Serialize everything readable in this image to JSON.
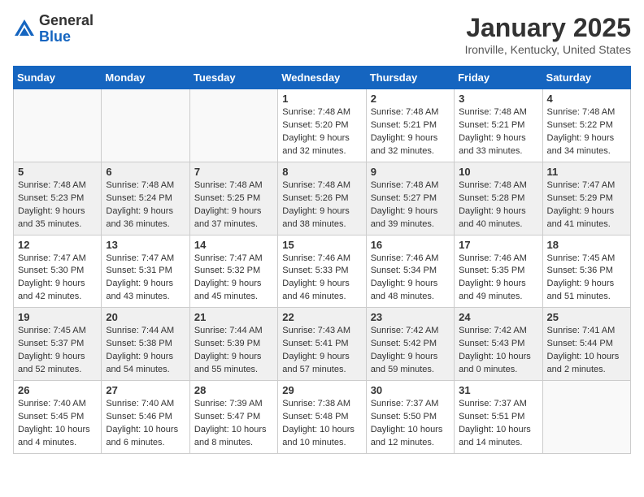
{
  "header": {
    "logo_general": "General",
    "logo_blue": "Blue",
    "month_title": "January 2025",
    "location": "Ironville, Kentucky, United States"
  },
  "days_of_week": [
    "Sunday",
    "Monday",
    "Tuesday",
    "Wednesday",
    "Thursday",
    "Friday",
    "Saturday"
  ],
  "weeks": [
    [
      {
        "day": "",
        "info": ""
      },
      {
        "day": "",
        "info": ""
      },
      {
        "day": "",
        "info": ""
      },
      {
        "day": "1",
        "info": "Sunrise: 7:48 AM\nSunset: 5:20 PM\nDaylight: 9 hours and 32 minutes."
      },
      {
        "day": "2",
        "info": "Sunrise: 7:48 AM\nSunset: 5:21 PM\nDaylight: 9 hours and 32 minutes."
      },
      {
        "day": "3",
        "info": "Sunrise: 7:48 AM\nSunset: 5:21 PM\nDaylight: 9 hours and 33 minutes."
      },
      {
        "day": "4",
        "info": "Sunrise: 7:48 AM\nSunset: 5:22 PM\nDaylight: 9 hours and 34 minutes."
      }
    ],
    [
      {
        "day": "5",
        "info": "Sunrise: 7:48 AM\nSunset: 5:23 PM\nDaylight: 9 hours and 35 minutes."
      },
      {
        "day": "6",
        "info": "Sunrise: 7:48 AM\nSunset: 5:24 PM\nDaylight: 9 hours and 36 minutes."
      },
      {
        "day": "7",
        "info": "Sunrise: 7:48 AM\nSunset: 5:25 PM\nDaylight: 9 hours and 37 minutes."
      },
      {
        "day": "8",
        "info": "Sunrise: 7:48 AM\nSunset: 5:26 PM\nDaylight: 9 hours and 38 minutes."
      },
      {
        "day": "9",
        "info": "Sunrise: 7:48 AM\nSunset: 5:27 PM\nDaylight: 9 hours and 39 minutes."
      },
      {
        "day": "10",
        "info": "Sunrise: 7:48 AM\nSunset: 5:28 PM\nDaylight: 9 hours and 40 minutes."
      },
      {
        "day": "11",
        "info": "Sunrise: 7:47 AM\nSunset: 5:29 PM\nDaylight: 9 hours and 41 minutes."
      }
    ],
    [
      {
        "day": "12",
        "info": "Sunrise: 7:47 AM\nSunset: 5:30 PM\nDaylight: 9 hours and 42 minutes."
      },
      {
        "day": "13",
        "info": "Sunrise: 7:47 AM\nSunset: 5:31 PM\nDaylight: 9 hours and 43 minutes."
      },
      {
        "day": "14",
        "info": "Sunrise: 7:47 AM\nSunset: 5:32 PM\nDaylight: 9 hours and 45 minutes."
      },
      {
        "day": "15",
        "info": "Sunrise: 7:46 AM\nSunset: 5:33 PM\nDaylight: 9 hours and 46 minutes."
      },
      {
        "day": "16",
        "info": "Sunrise: 7:46 AM\nSunset: 5:34 PM\nDaylight: 9 hours and 48 minutes."
      },
      {
        "day": "17",
        "info": "Sunrise: 7:46 AM\nSunset: 5:35 PM\nDaylight: 9 hours and 49 minutes."
      },
      {
        "day": "18",
        "info": "Sunrise: 7:45 AM\nSunset: 5:36 PM\nDaylight: 9 hours and 51 minutes."
      }
    ],
    [
      {
        "day": "19",
        "info": "Sunrise: 7:45 AM\nSunset: 5:37 PM\nDaylight: 9 hours and 52 minutes."
      },
      {
        "day": "20",
        "info": "Sunrise: 7:44 AM\nSunset: 5:38 PM\nDaylight: 9 hours and 54 minutes."
      },
      {
        "day": "21",
        "info": "Sunrise: 7:44 AM\nSunset: 5:39 PM\nDaylight: 9 hours and 55 minutes."
      },
      {
        "day": "22",
        "info": "Sunrise: 7:43 AM\nSunset: 5:41 PM\nDaylight: 9 hours and 57 minutes."
      },
      {
        "day": "23",
        "info": "Sunrise: 7:42 AM\nSunset: 5:42 PM\nDaylight: 9 hours and 59 minutes."
      },
      {
        "day": "24",
        "info": "Sunrise: 7:42 AM\nSunset: 5:43 PM\nDaylight: 10 hours and 0 minutes."
      },
      {
        "day": "25",
        "info": "Sunrise: 7:41 AM\nSunset: 5:44 PM\nDaylight: 10 hours and 2 minutes."
      }
    ],
    [
      {
        "day": "26",
        "info": "Sunrise: 7:40 AM\nSunset: 5:45 PM\nDaylight: 10 hours and 4 minutes."
      },
      {
        "day": "27",
        "info": "Sunrise: 7:40 AM\nSunset: 5:46 PM\nDaylight: 10 hours and 6 minutes."
      },
      {
        "day": "28",
        "info": "Sunrise: 7:39 AM\nSunset: 5:47 PM\nDaylight: 10 hours and 8 minutes."
      },
      {
        "day": "29",
        "info": "Sunrise: 7:38 AM\nSunset: 5:48 PM\nDaylight: 10 hours and 10 minutes."
      },
      {
        "day": "30",
        "info": "Sunrise: 7:37 AM\nSunset: 5:50 PM\nDaylight: 10 hours and 12 minutes."
      },
      {
        "day": "31",
        "info": "Sunrise: 7:37 AM\nSunset: 5:51 PM\nDaylight: 10 hours and 14 minutes."
      },
      {
        "day": "",
        "info": ""
      }
    ]
  ]
}
